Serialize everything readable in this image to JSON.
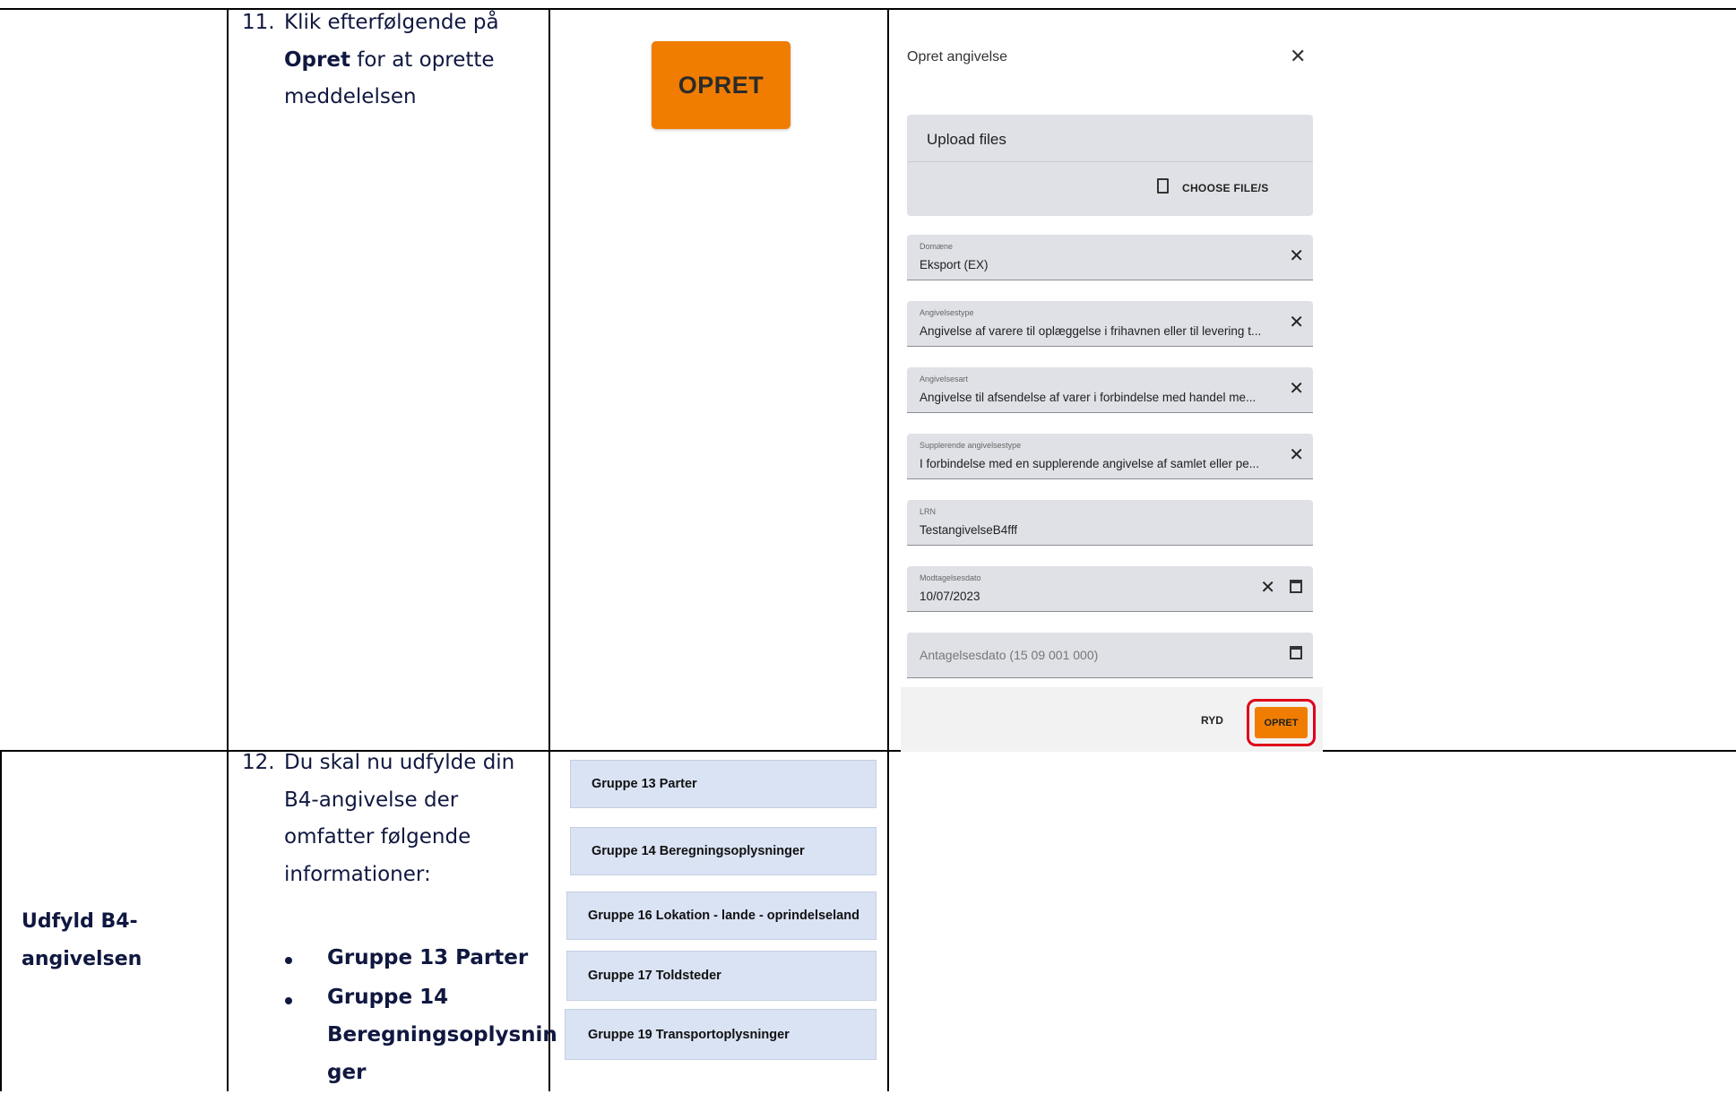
{
  "step11": {
    "number": "11.",
    "line1": "Klik efterfølgende på",
    "line2_bold": "Opret",
    "line2_rest": " for at oprette",
    "line3": "meddelelsen"
  },
  "big_button": {
    "label": "OPRET"
  },
  "dialog": {
    "title": "Opret angivelse",
    "upload_title": "Upload files",
    "choose_label": "CHOOSE FILE/S",
    "fields": [
      {
        "label": "Domæne",
        "value": "Eksport (EX)"
      },
      {
        "label": "Angivelsestype",
        "value": "Angivelse af varere til oplæggelse i frihavnen eller til levering t..."
      },
      {
        "label": "Angivelsesart",
        "value": "Angivelse til afsendelse af varer i forbindelse med handel me..."
      },
      {
        "label": "Supplerende angivelsestype",
        "value": "I forbindelse med en supplerende angivelse af samlet eller pe..."
      },
      {
        "label": "LRN",
        "value": "TestangivelseB4fff"
      },
      {
        "label": "Modtagelsesdato",
        "value": "10/07/2023"
      },
      {
        "placeholder": "Antagelsesdato (15 09 001 000)"
      }
    ],
    "ryd_label": "RYD",
    "opret_label": "OPRET"
  },
  "row2": {
    "side_label_line1": "Udfyld B4-",
    "side_label_line2": "angivelsen",
    "number": "12.",
    "lines": [
      "Du skal nu udfylde din",
      "B4-angivelse der",
      "omfatter følgende",
      "informationer:"
    ],
    "bullets": [
      {
        "line1": "Gruppe 13 Parter"
      },
      {
        "line1": "Gruppe 14",
        "line2": "Beregningsoplysnin",
        "line3": "ger"
      }
    ],
    "groups": [
      "Gruppe 13 Parter",
      "Gruppe 14 Beregningsoplysninger",
      "Gruppe 16 Lokation - lande - oprindelseland",
      "Gruppe 17 Toldsteder",
      "Gruppe 19 Transportoplysninger"
    ]
  }
}
